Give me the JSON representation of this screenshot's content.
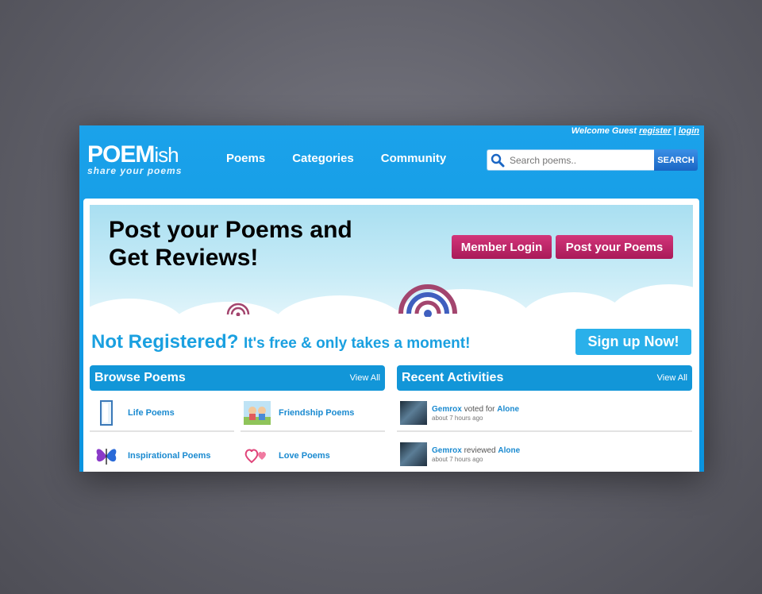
{
  "header": {
    "welcome_text": "Welcome Guest",
    "register_link": "register",
    "separator": "|",
    "login_link": "login",
    "logo_main": "POEM",
    "logo_suffix": "ish",
    "logo_tagline": "share your poems",
    "nav": [
      "Poems",
      "Categories",
      "Community"
    ],
    "search_placeholder": "Search poems..",
    "search_button": "SEARCH"
  },
  "hero": {
    "title_line1": "Post your Poems and",
    "title_line2": "Get Reviews!",
    "member_login_button": "Member Login",
    "post_poems_button": "Post your Poems"
  },
  "signup": {
    "not_registered": "Not Registered?",
    "free_text": "It's free & only takes a moment!",
    "signup_button": "Sign up Now!"
  },
  "browse": {
    "title": "Browse Poems",
    "view_all": "View All",
    "categories": [
      {
        "label": "Life Poems",
        "icon": "door-icon"
      },
      {
        "label": "Friendship Poems",
        "icon": "friends-icon"
      },
      {
        "label": "Inspirational Poems",
        "icon": "butterfly-icon"
      },
      {
        "label": "Love Poems",
        "icon": "hearts-icon"
      }
    ]
  },
  "activities": {
    "title": "Recent Activities",
    "view_all": "View All",
    "items": [
      {
        "user": "Gemrox",
        "action": "voted for",
        "target": "Alone",
        "time": "about 7 hours ago"
      },
      {
        "user": "Gemrox",
        "action": "reviewed",
        "target": "Alone",
        "time": "about 7 hours ago"
      }
    ]
  },
  "colors": {
    "header_blue": "#0a94e0",
    "accent_pink": "#b8226a",
    "link_blue": "#1a8ad0"
  }
}
